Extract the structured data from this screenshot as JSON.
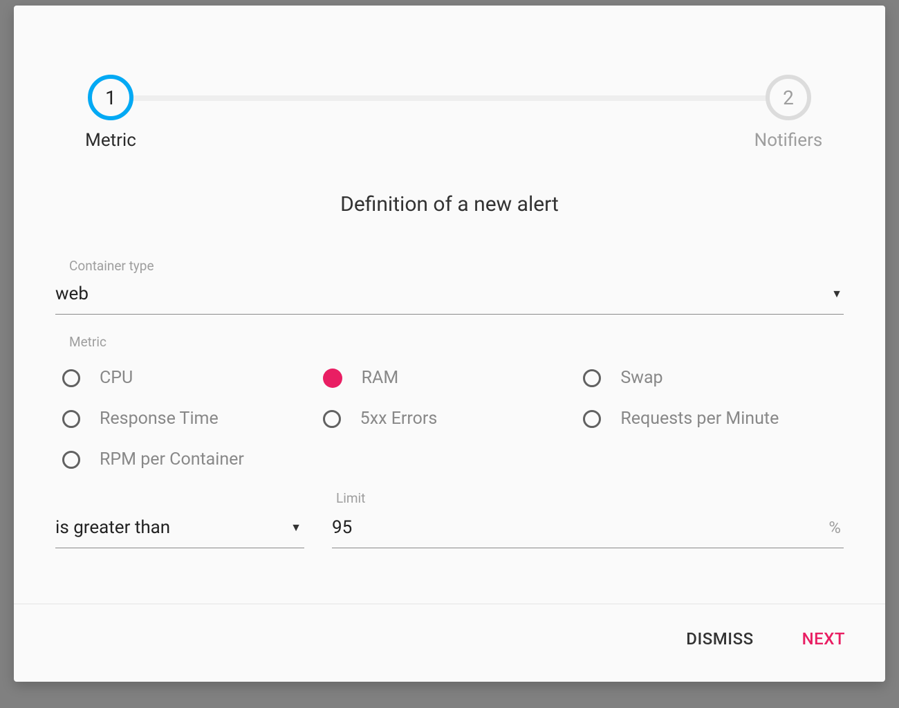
{
  "stepper": {
    "steps": [
      {
        "num": "1",
        "label": "Metric",
        "active": true
      },
      {
        "num": "2",
        "label": "Notifiers",
        "active": false
      }
    ]
  },
  "heading": "Definition of a new alert",
  "containerType": {
    "label": "Container type",
    "value": "web"
  },
  "metric": {
    "label": "Metric",
    "options": [
      {
        "label": "CPU",
        "selected": false
      },
      {
        "label": "RAM",
        "selected": true
      },
      {
        "label": "Swap",
        "selected": false
      },
      {
        "label": "Response Time",
        "selected": false
      },
      {
        "label": "5xx Errors",
        "selected": false
      },
      {
        "label": "Requests per Minute",
        "selected": false
      },
      {
        "label": "RPM per Container",
        "selected": false
      }
    ]
  },
  "operator": {
    "value": "is greater than"
  },
  "limit": {
    "label": "Limit",
    "value": "95",
    "unit": "%"
  },
  "footer": {
    "dismiss": "DISMISS",
    "next": "NEXT"
  }
}
